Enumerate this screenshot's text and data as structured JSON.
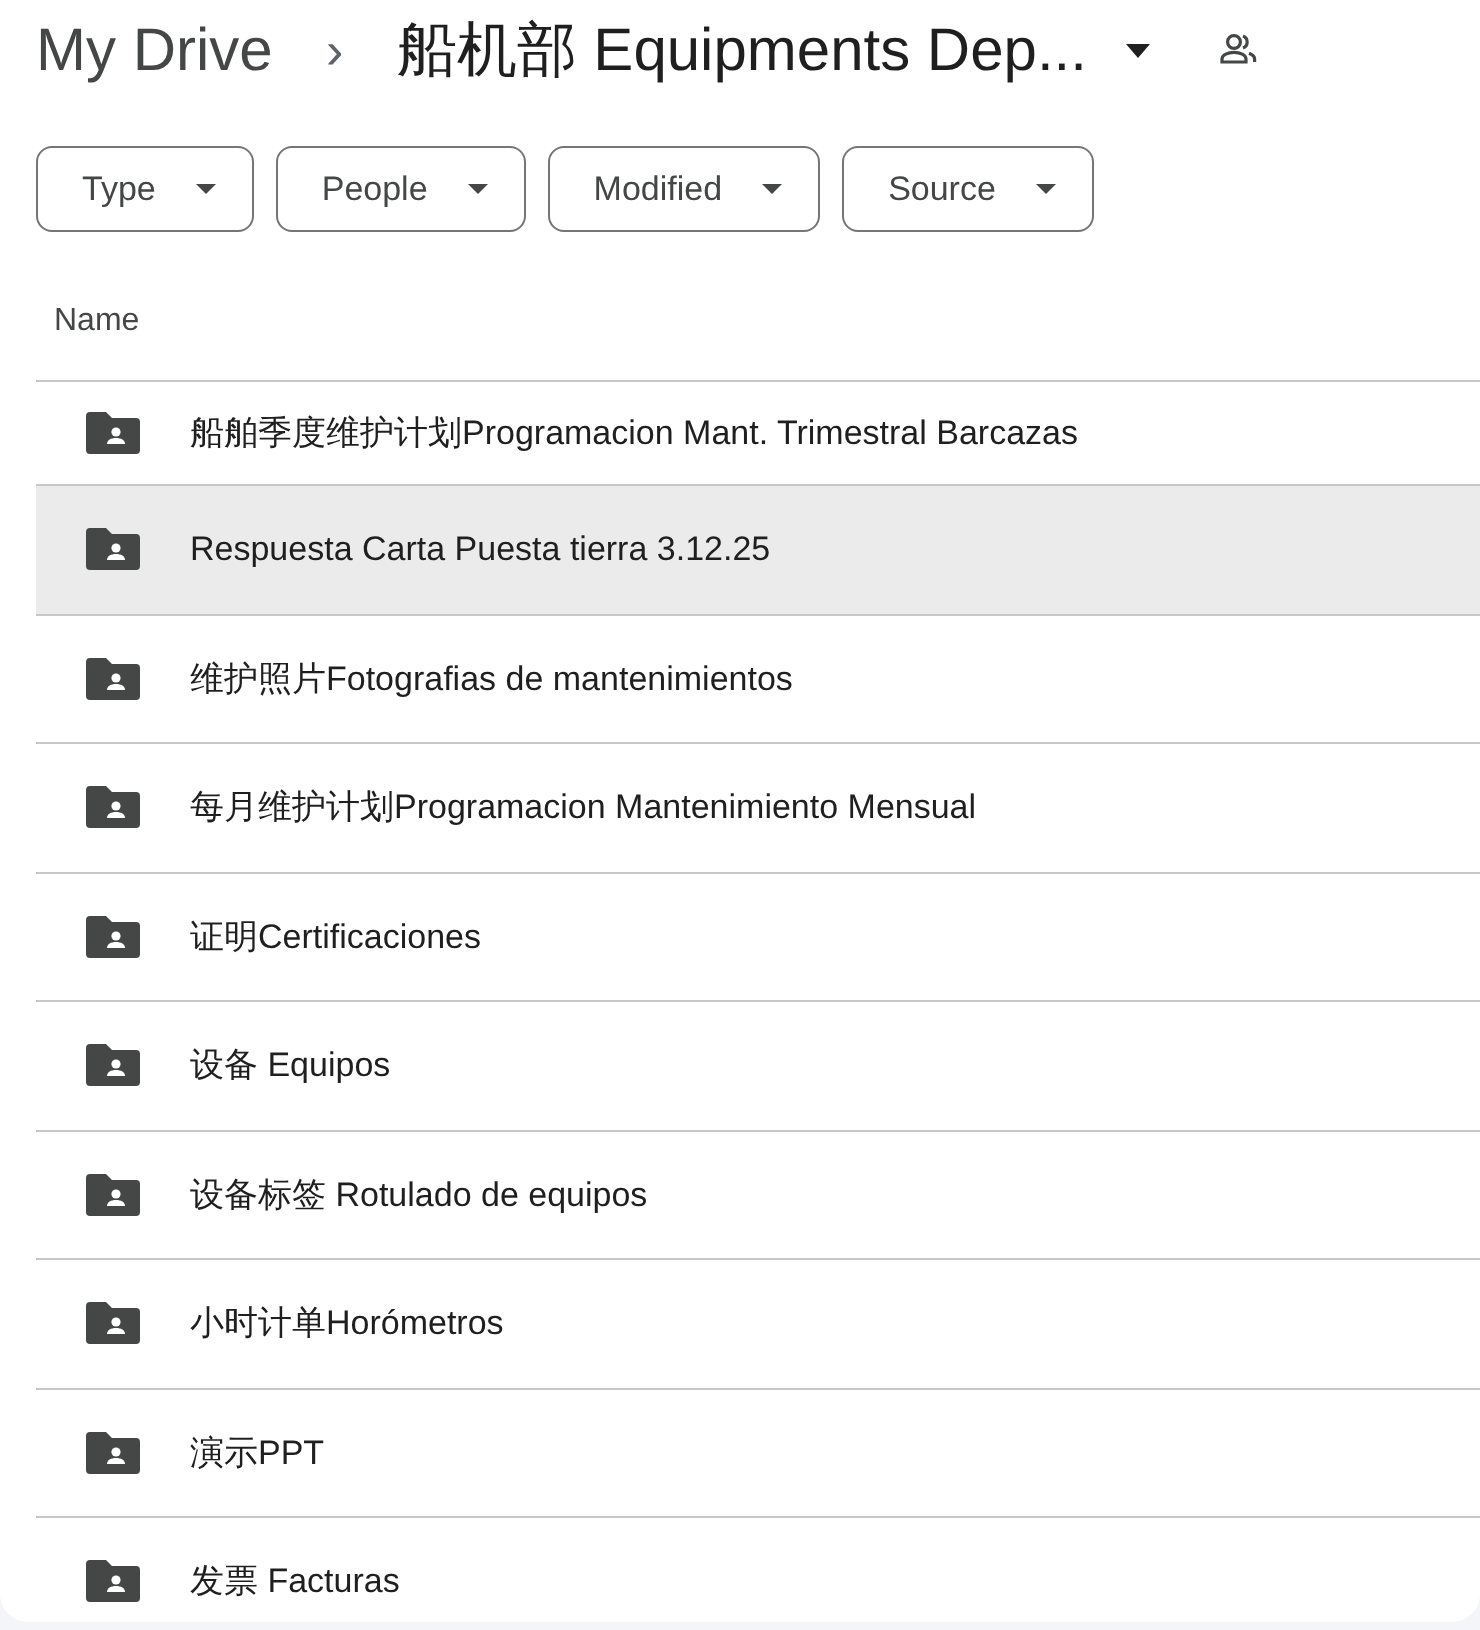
{
  "breadcrumb": {
    "root": "My Drive",
    "separator": "›",
    "current": "船机部 Equipments Dep..."
  },
  "filters": [
    {
      "label": "Type"
    },
    {
      "label": "People"
    },
    {
      "label": "Modified"
    },
    {
      "label": "Source"
    }
  ],
  "table": {
    "columns": [
      "Name"
    ],
    "rows": [
      {
        "name": "船舶季度维护计划Programacion Mant. Trimestral Barcazas",
        "selected": false
      },
      {
        "name": "Respuesta Carta Puesta tierra 3.12.25",
        "selected": true
      },
      {
        "name": "维护照片Fotografias de mantenimientos",
        "selected": false
      },
      {
        "name": "每月维护计划Programacion Mantenimiento Mensual",
        "selected": false
      },
      {
        "name": "证明Certificaciones",
        "selected": false
      },
      {
        "name": "设备 Equipos",
        "selected": false
      },
      {
        "name": "设备标签 Rotulado de equipos",
        "selected": false
      },
      {
        "name": "小时计单Horómetros",
        "selected": false
      },
      {
        "name": "演示PPT",
        "selected": false
      },
      {
        "name": "发票 Facturas",
        "selected": false
      }
    ]
  }
}
